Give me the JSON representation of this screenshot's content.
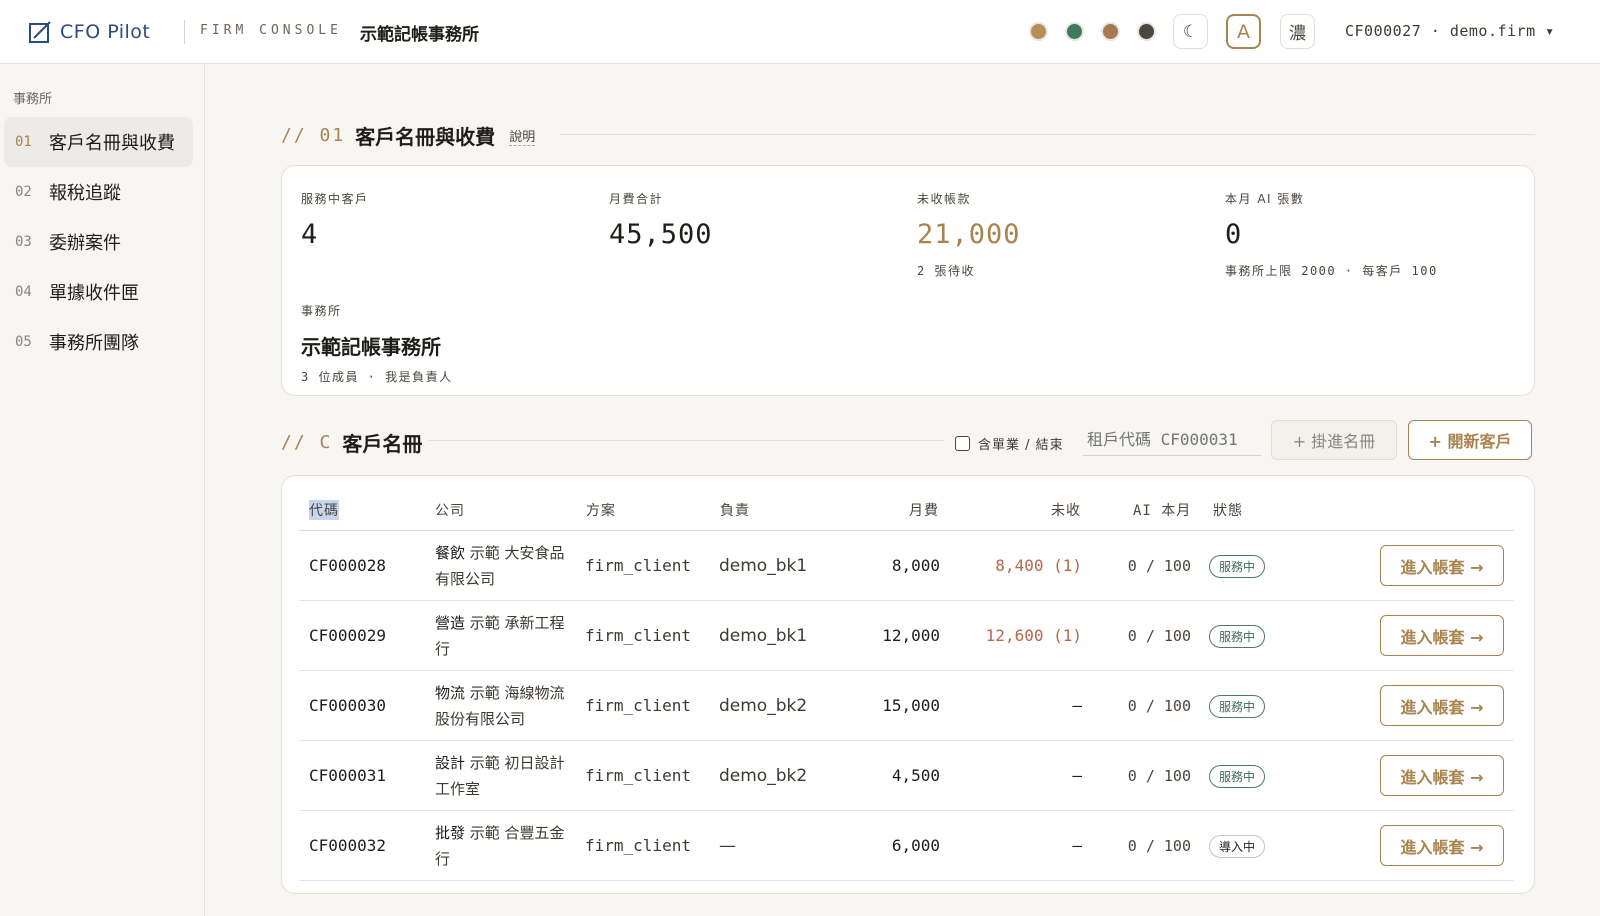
{
  "header": {
    "brand": "CFO Pilot",
    "console_label": "FIRM CONSOLE",
    "firm_title": "示範記帳事務所",
    "theme_swatches": [
      "#b58e59",
      "#3f7a5e",
      "#a47a53",
      "#4a4640"
    ],
    "dark_toggle": "☾",
    "font_toggle": "A",
    "density_toggle": "濃",
    "tenant_menu": "CF000027 · demo.firm ▾"
  },
  "sidebar": {
    "heading": "事務所",
    "items": [
      {
        "num": "01",
        "label": "客戶名冊與收費",
        "active": true
      },
      {
        "num": "02",
        "label": "報稅追蹤",
        "active": false
      },
      {
        "num": "03",
        "label": "委辦案件",
        "active": false
      },
      {
        "num": "04",
        "label": "單據收件匣",
        "active": false
      },
      {
        "num": "05",
        "label": "事務所團隊",
        "active": false
      }
    ]
  },
  "overview": {
    "prefix": "// 01",
    "title": "客戶名冊與收費",
    "note": "說明",
    "stats": [
      {
        "label": "服務中客戶",
        "value": "4",
        "sub": ""
      },
      {
        "label": "月費合計",
        "value": "45,500",
        "sub": ""
      },
      {
        "label": "未收帳款",
        "value": "21,000",
        "sub": "2 張待收"
      },
      {
        "label": "本月 AI 張數",
        "value": "0",
        "sub": "事務所上限 2000 · 每客戶 100"
      }
    ],
    "firm": {
      "label": "事務所",
      "name": "示範記帳事務所",
      "sub": "3 位成員 · 我是負責人"
    }
  },
  "roster": {
    "prefix": "// C",
    "title": "客戶名冊",
    "include_closed_label": "含單業 / 結束",
    "tenant_input_placeholder": "租戶代碼 CF000031",
    "attach_button": "+ 掛進名冊",
    "new_client_button": "+ 開新客戶",
    "columns": [
      "代碼",
      "公司",
      "方案",
      "負責",
      "月費",
      "未收",
      "AI 本月",
      "狀態"
    ],
    "rows": [
      {
        "code": "CF000028",
        "co_head": "餐飲",
        "co_rest": " 示範 大安食品有限公司",
        "plan": "firm_client",
        "owner": "demo_bk1",
        "fee": "8,000",
        "ar": "8,400 (1)",
        "ai": "0 / 100",
        "status": "服務中",
        "action": "進入帳套 →"
      },
      {
        "code": "CF000029",
        "co_head": "營造",
        "co_rest": " 示範 承新工程行",
        "plan": "firm_client",
        "owner": "demo_bk1",
        "fee": "12,000",
        "ar": "12,600 (1)",
        "ai": "0 / 100",
        "status": "服務中",
        "action": "進入帳套 →"
      },
      {
        "code": "CF000030",
        "co_head": "物流",
        "co_rest": " 示範 海線物流股份有限公司",
        "plan": "firm_client",
        "owner": "demo_bk2",
        "fee": "15,000",
        "ar": "—",
        "ai": "0 / 100",
        "status": "服務中",
        "action": "進入帳套 →"
      },
      {
        "code": "CF000031",
        "co_head": "設計",
        "co_rest": " 示範 初日設計工作室",
        "plan": "firm_client",
        "owner": "demo_bk2",
        "fee": "4,500",
        "ar": "—",
        "ai": "0 / 100",
        "status": "服務中",
        "action": "進入帳套 →"
      },
      {
        "code": "CF000032",
        "co_head": "批發",
        "co_rest": " 示範 合豐五金行",
        "plan": "firm_client",
        "owner": "—",
        "fee": "6,000",
        "ar": "—",
        "ai": "0 / 100",
        "status": "導入中",
        "action": "進入帳套 →"
      }
    ]
  },
  "colors": {
    "accent": "#a98450",
    "brand": "#2b4a86",
    "live": "#3e6a5b",
    "overdue": "#b8674a"
  }
}
